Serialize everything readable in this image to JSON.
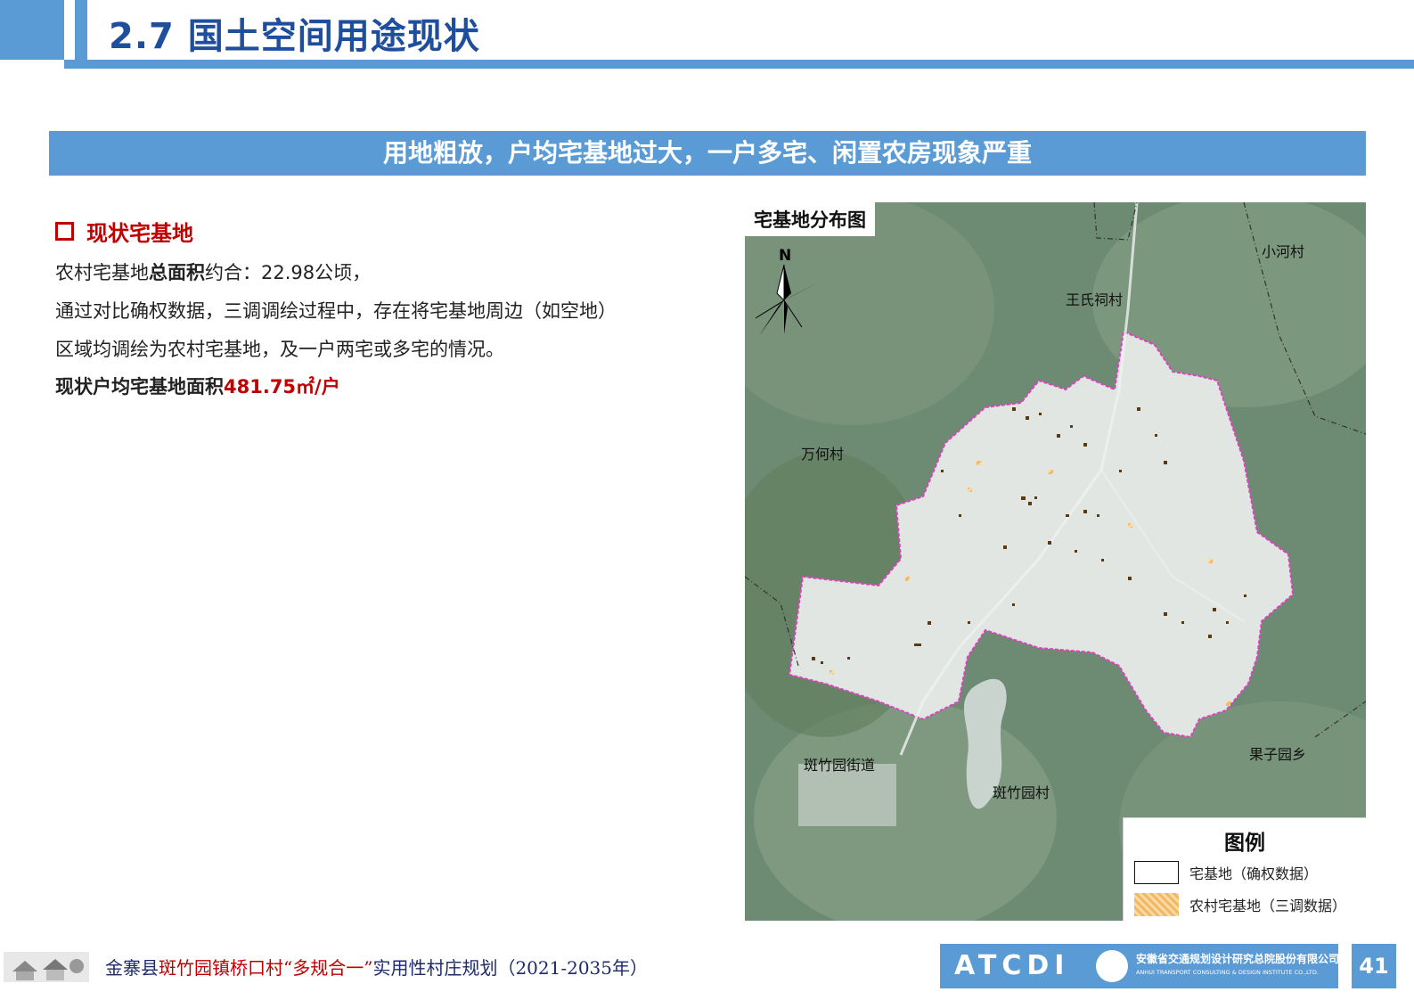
{
  "header": {
    "title": "2.7 国土空间用途现状"
  },
  "banner": {
    "text": "用地粗放，户均宅基地过大，一户多宅、闲置农房现象严重"
  },
  "section": {
    "heading": "现状宅基地",
    "line1_a": "农村宅基地",
    "line1_b": "总面积",
    "line1_c": "约合：22.98公顷，",
    "line2": "通过对比确权数据，三调调绘过程中，存在将宅基地周边（如空地）",
    "line3": "区域均调绘为农村宅基地，及一户两宅或多宅的情况。",
    "line4_a": "现状户均宅基地面积",
    "line4_b": "481.75㎡/户"
  },
  "map": {
    "title": "宅基地分布图",
    "north_label": "N",
    "places": {
      "xiaohe": "小河村",
      "wangshi": "王氏祠村",
      "wanhe": "万何村",
      "guoziyuan": "果子园乡",
      "banzhuyuan_street": "斑竹园街道",
      "banzhuyuan_village": "斑竹园村"
    },
    "legend": {
      "title": "图例",
      "item1": "宅基地（确权数据）",
      "item2": "农村宅基地（三调数据）"
    },
    "colors": {
      "boundary": "#e040c0",
      "homestead": "#f2b865"
    }
  },
  "footer": {
    "plan_a": "金寨县",
    "plan_b": "斑竹园镇桥口村“多规合一”",
    "plan_c": "实用性村庄规划（2021-2035年）",
    "logo_text": "ATCDI",
    "company_cn": "安徽省交通规划设计研究总院股份有限公司",
    "company_en": "ANHUI TRANSPORT CONSULTING & DESIGN INSTITUTE CO.,LTD.",
    "page": "41"
  }
}
